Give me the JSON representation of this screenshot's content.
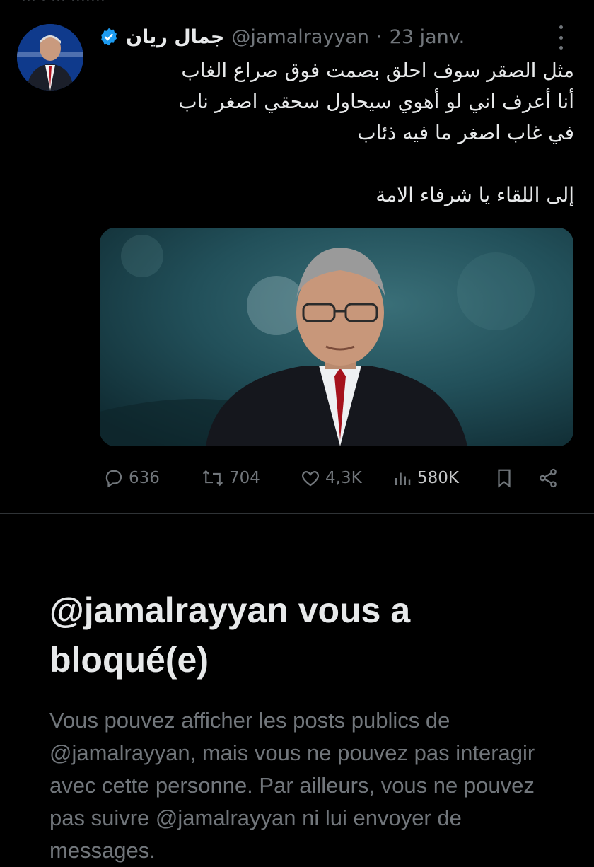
{
  "tweet": {
    "author_name": "جمال ريان",
    "handle": "@jamalrayyan",
    "separator": "·",
    "date": "23 janv.",
    "text_lines": [
      "مثل الصقر سوف احلق بصمت فوق صراع الغاب",
      "أنا أعرف اني لو أهوي سيحاول سحقي اصغر ناب",
      "في غاب اصغر ما فيه ذئاب",
      "",
      "إلى اللقاء يا شرفاء الامة"
    ],
    "stats": {
      "replies": "636",
      "reposts": "704",
      "likes": "4,3K",
      "views": "580K"
    }
  },
  "blocked": {
    "title": "@jamalrayyan vous a bloqué(e)",
    "description": "Vous pouvez afficher les posts publics de @jamalrayyan, mais vous ne pouvez pas interagir avec cette personne. Par ailleurs, vous ne pouvez pas suivre @jamalrayyan ni lui envoyer de messages."
  },
  "colors": {
    "background": "#000000",
    "text": "#e7e9ea",
    "muted": "#71767b",
    "verified": "#1d9bf0",
    "divider": "#2f3336"
  },
  "icons": [
    "verified-badge-icon",
    "more-icon",
    "reply-icon",
    "repost-icon",
    "like-icon",
    "views-icon",
    "bookmark-icon",
    "share-icon"
  ]
}
